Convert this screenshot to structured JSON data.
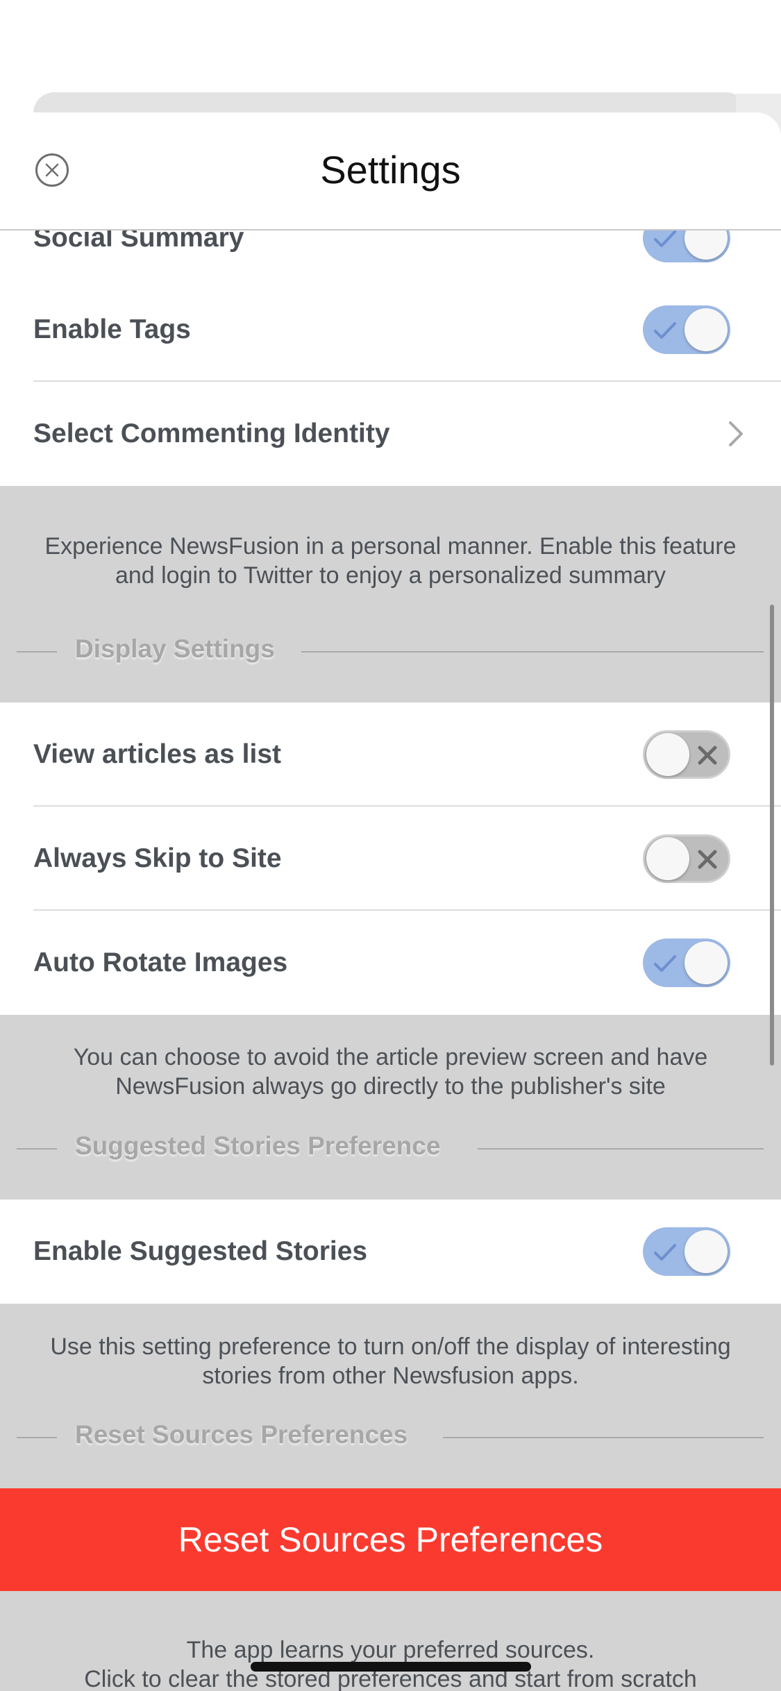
{
  "header": {
    "title": "Settings",
    "close_icon": "close-circle-icon"
  },
  "rows": {
    "social_summary": {
      "label": "Social Summary",
      "on": true
    },
    "enable_tags": {
      "label": "Enable Tags",
      "on": true
    },
    "commenting_identity": {
      "label": "Select Commenting Identity",
      "icon": "chevron-right-icon"
    },
    "view_as_list": {
      "label": "View articles as list",
      "on": false
    },
    "skip_to_site": {
      "label": "Always Skip to Site",
      "on": false
    },
    "auto_rotate": {
      "label": "Auto Rotate Images",
      "on": true
    },
    "suggested_stories": {
      "label": "Enable Suggested Stories",
      "on": true
    }
  },
  "sections": {
    "personal": {
      "description_line1": "Experience NewsFusion in a personal manner. Enable this feature",
      "description_line2": "and login to Twitter to enjoy a personalized summary"
    },
    "display": {
      "title": "Display Settings",
      "description_line1": "You can choose to avoid the article preview screen and have",
      "description_line2": "NewsFusion always go directly to the publisher's site"
    },
    "suggested": {
      "title": "Suggested Stories Preference",
      "description_line1": "Use this setting preference to turn on/off the display of interesting",
      "description_line2": "stories from other Newsfusion apps."
    },
    "reset": {
      "title": "Reset Sources Preferences",
      "button_label": "Reset Sources Preferences",
      "description_line1": "The app learns your preferred sources.",
      "description_line2": "Click to clear the stored preferences and start from scratch"
    }
  },
  "colors": {
    "toggle_on": "#9db9e6",
    "toggle_off": "#bdbdbd",
    "reset_button": "#fb3a2f",
    "section_background": "#d3d3d3"
  }
}
